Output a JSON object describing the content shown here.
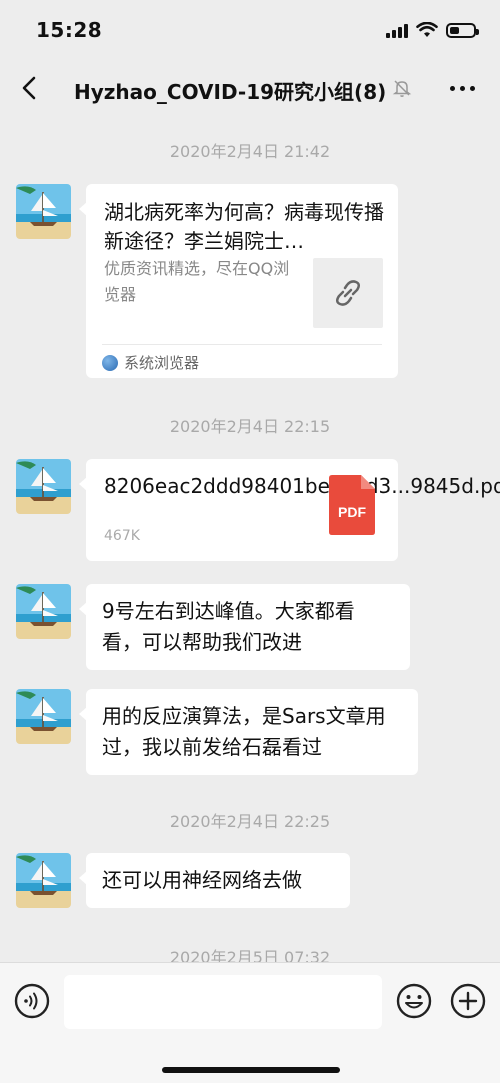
{
  "status_bar": {
    "time": "15:28",
    "icons": [
      "signal-icon",
      "wifi-icon",
      "battery-icon"
    ]
  },
  "nav": {
    "back_icon": "chevron-left-icon",
    "title": "Hyzhao_COVID-19研究小组(8)",
    "mute_icon": "bell-off-icon",
    "more_icon": "more-horizontal-icon"
  },
  "chat": {
    "timestamps": [
      "2020年2月4日 21:42",
      "2020年2月4日 22:15",
      "2020年2月4日 22:25",
      "2020年2月5日 07:32"
    ],
    "link_card": {
      "title": "湖北病死率为何高？病毒现传播新途径？李兰娟院士…",
      "description": "优质资讯精选，尽在QQ浏览器",
      "thumb_icon": "link-icon",
      "source_icon": "globe-icon",
      "source": "系统浏览器"
    },
    "file_card": {
      "file_name": "8206eac2ddd98401bec8ad3...9845d.pdf",
      "file_size": "467K",
      "file_icon": "pdf-file-icon",
      "file_icon_label": "PDF"
    },
    "text_messages": [
      "9号左右到达峰值。大家都看看，可以帮助我们改进",
      "用的反应演算法，是Sars文章用过，我以前发给石磊看过",
      "还可以用神经网络去做"
    ],
    "avatar_icon": "sailboat-avatar"
  },
  "input_bar": {
    "voice_icon": "voice-icon",
    "message_value": "",
    "emoji_icon": "emoji-icon",
    "plus_icon": "plus-circle-icon"
  },
  "colors": {
    "background": "#ededed",
    "bubble": "#ffffff",
    "timestamp": "#a9a9a9",
    "pdf_red": "#e94b3c"
  }
}
